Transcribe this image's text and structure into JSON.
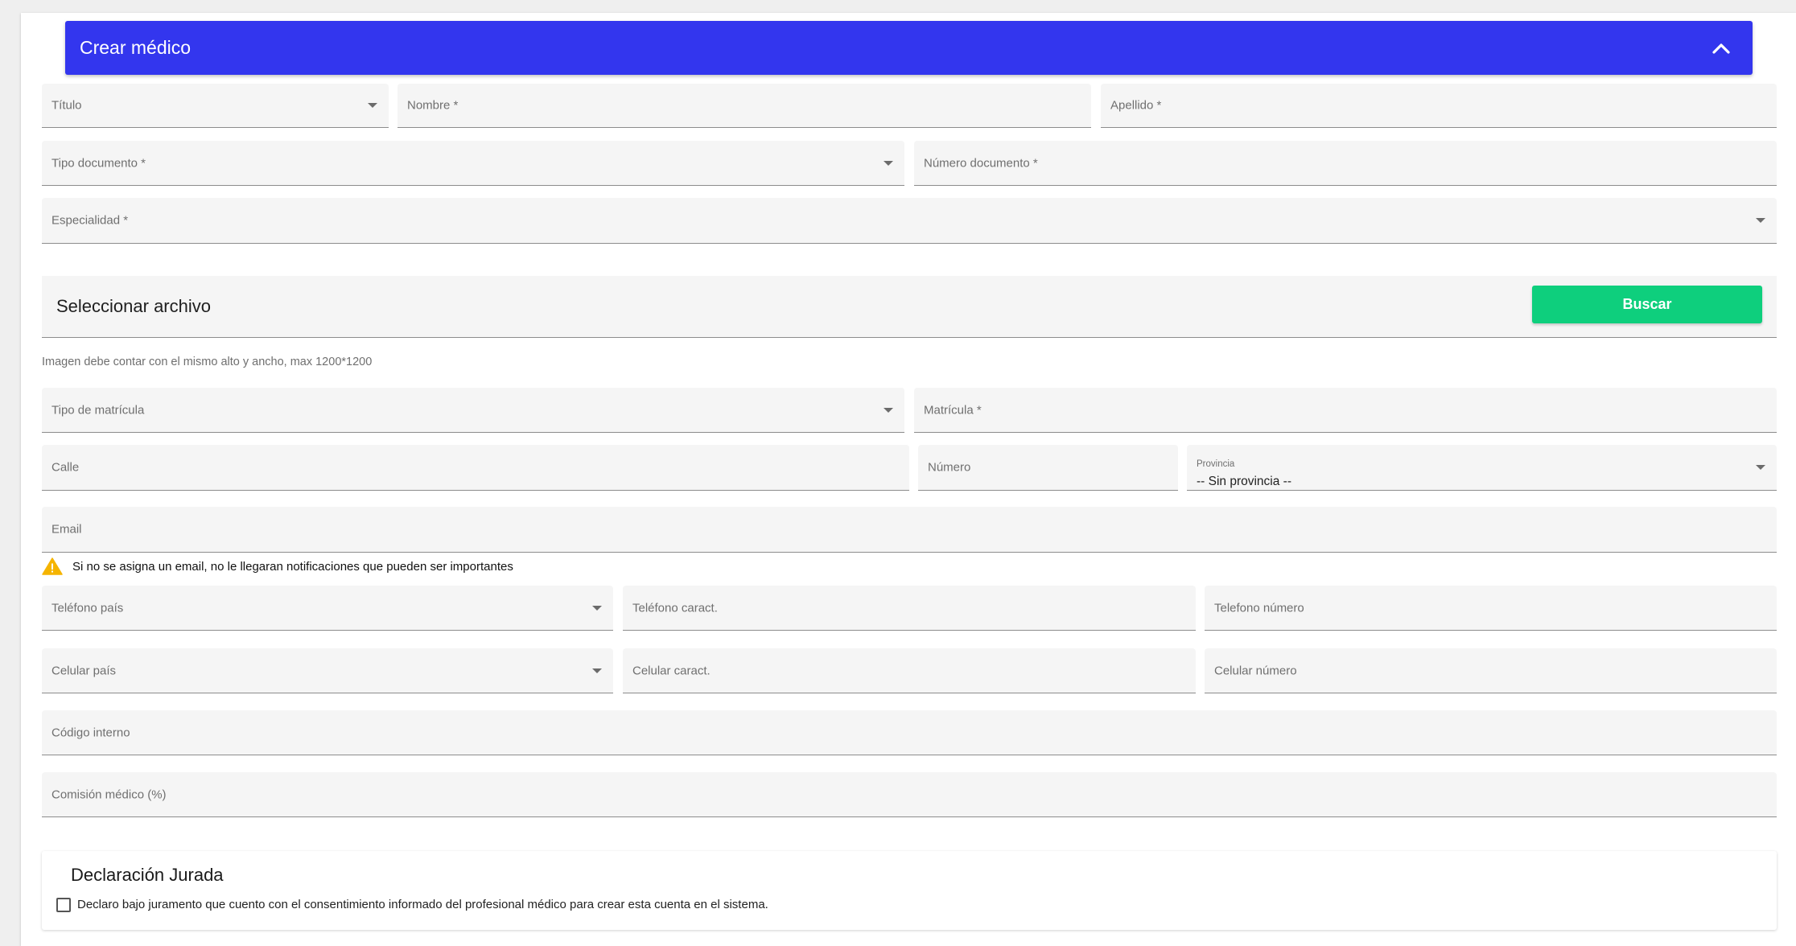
{
  "header": {
    "title": "Crear médico"
  },
  "fields": {
    "titulo": "Título",
    "nombre": "Nombre *",
    "apellido": "Apellido *",
    "tipo_documento": "Tipo documento *",
    "numero_documento": "Número documento *",
    "especialidad": "Especialidad *",
    "tipo_matricula": "Tipo de matrícula",
    "matricula": "Matrícula *",
    "calle": "Calle",
    "numero": "Número",
    "provincia_label": "Provincia",
    "provincia_value": "-- Sin provincia --",
    "email": "Email",
    "telefono_pais": "Teléfono país",
    "telefono_caract": "Teléfono caract.",
    "telefono_numero": "Telefono número",
    "celular_pais": "Celular país",
    "celular_caract": "Celular caract.",
    "celular_numero": "Celular número",
    "codigo_interno": "Código interno",
    "comision": "Comisión médico (%)"
  },
  "file": {
    "title": "Seleccionar archivo",
    "button_label": "Buscar",
    "hint": "Imagen debe contar con el mismo alto y ancho, max 1200*1200"
  },
  "warning": {
    "text": "Si no se asigna un email, no le llegaran notificaciones que pueden ser importantes"
  },
  "declaracion": {
    "title": "Declaración Jurada",
    "checkbox_label": "Declaro bajo juramento que cuento con el consentimiento informado del profesional médico para crear esta cuenta en el sistema."
  },
  "colors": {
    "header": "#3336ee",
    "button": "#0ecf7d",
    "warning": "#f5b400"
  },
  "icons": {
    "header_toggle": "chevron-up-icon",
    "warning": "warning-icon"
  }
}
